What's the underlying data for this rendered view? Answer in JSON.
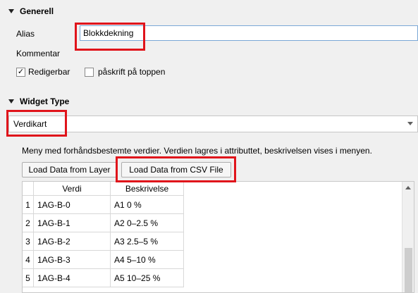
{
  "generell": {
    "header": "Generell",
    "alias_label": "Alias",
    "alias_value": "Blokkdekning",
    "kommentar_label": "Kommentar",
    "redigerbar_label": "Redigerbar",
    "redigerbar_checked": true,
    "paskrift_label": "påskrift på toppen",
    "paskrift_checked": false
  },
  "widget_type": {
    "header": "Widget Type",
    "selected": "Verdikart",
    "description": "Meny med forhåndsbestemte verdier. Verdien lagres i attributtet, beskrivelsen vises i menyen.",
    "load_layer_button": "Load Data from Layer",
    "load_csv_button": "Load Data from CSV File"
  },
  "table": {
    "columns": [
      "Verdi",
      "Beskrivelse"
    ],
    "rows": [
      {
        "num": "1",
        "verdi": "1AG-B-0",
        "beskrivelse": "A1 0 %"
      },
      {
        "num": "2",
        "verdi": "1AG-B-1",
        "beskrivelse": "A2 0–2.5 %"
      },
      {
        "num": "3",
        "verdi": "1AG-B-2",
        "beskrivelse": "A3 2.5–5 %"
      },
      {
        "num": "4",
        "verdi": "1AG-B-3",
        "beskrivelse": "A4 5–10 %"
      },
      {
        "num": "5",
        "verdi": "1AG-B-4",
        "beskrivelse": "A5 10–25 %"
      }
    ]
  },
  "colors": {
    "highlight": "#e0141b",
    "focus_border": "#7aa7d6"
  }
}
